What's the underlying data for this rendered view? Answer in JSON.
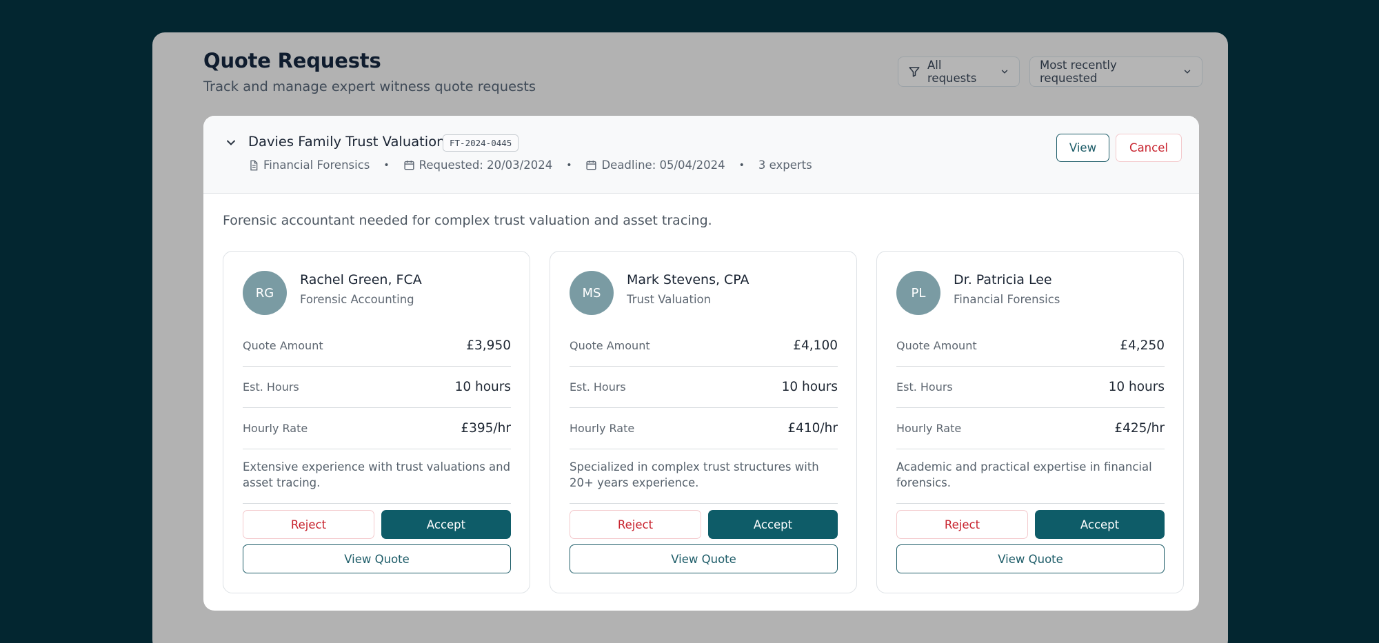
{
  "header": {
    "title": "Quote Requests",
    "subtitle": "Track and manage expert witness quote requests",
    "filter_label": "All requests",
    "sort_label": "Most recently requested"
  },
  "request": {
    "title": "Davies Family Trust Valuation",
    "id": "FT-2024-0445",
    "category": "Financial Forensics",
    "requested": "Requested: 20/03/2024",
    "deadline": "Deadline: 05/04/2024",
    "experts_count": "3 experts",
    "view_label": "View",
    "cancel_label": "Cancel",
    "description": "Forensic accountant needed for complex trust valuation and asset tracing."
  },
  "labels": {
    "quote_amount": "Quote Amount",
    "est_hours": "Est. Hours",
    "hourly_rate": "Hourly Rate",
    "reject": "Reject",
    "accept": "Accept",
    "view_quote": "View Quote"
  },
  "experts": [
    {
      "initials": "RG",
      "name": "Rachel Green, FCA",
      "specialty": "Forensic Accounting",
      "quote_amount": "£3,950",
      "est_hours": "10 hours",
      "hourly_rate": "£395/hr",
      "note": "Extensive experience with trust valuations and asset tracing."
    },
    {
      "initials": "MS",
      "name": "Mark Stevens, CPA",
      "specialty": "Trust Valuation",
      "quote_amount": "£4,100",
      "est_hours": "10 hours",
      "hourly_rate": "£410/hr",
      "note": "Specialized in complex trust structures with 20+ years experience."
    },
    {
      "initials": "PL",
      "name": "Dr. Patricia Lee",
      "specialty": "Financial Forensics",
      "quote_amount": "£4,250",
      "est_hours": "10 hours",
      "hourly_rate": "£425/hr",
      "note": "Academic and practical expertise in financial forensics."
    }
  ],
  "colors": {
    "page_bg": "#032630",
    "overlay_panel": "#b2b2b2",
    "primary": "#0e5c68",
    "danger": "#c8242f",
    "avatar": "#7a9ba3"
  },
  "icons": {
    "filter": "filter-icon",
    "chevron": "chevron-down-icon",
    "document": "document-icon",
    "calendar": "calendar-icon"
  }
}
